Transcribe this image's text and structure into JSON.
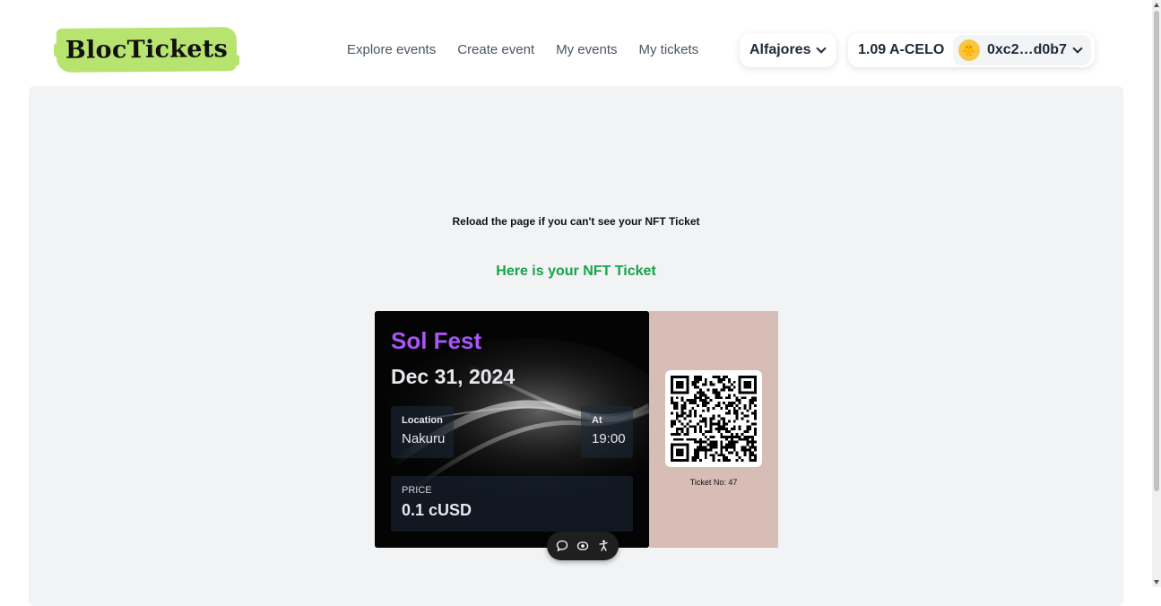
{
  "header": {
    "logo": "BlocTickets",
    "nav": [
      "Explore events",
      "Create event",
      "My events",
      "My tickets"
    ],
    "network": "Alfajores",
    "balance": "1.09 A-CELO",
    "address": "0xc2…d0b7",
    "avatar_emoji": "🐥"
  },
  "main": {
    "reload_msg": "Reload the page if you can't see your NFT Ticket",
    "heading": "Here is your NFT Ticket"
  },
  "ticket": {
    "event_name": "Sol Fest",
    "date": "Dec 31, 2024",
    "location_label": "Location",
    "location": "Nakuru",
    "time_label": "At",
    "time": "19:00",
    "price_label": "PRICE",
    "price": "0.1 cUSD",
    "ticket_no": "Ticket No: 47"
  },
  "colors": {
    "logo_bg": "#b7e36f",
    "event_name": "#a855f7",
    "heading": "#16a34a",
    "ticket_stub": "#d8bdb6"
  }
}
